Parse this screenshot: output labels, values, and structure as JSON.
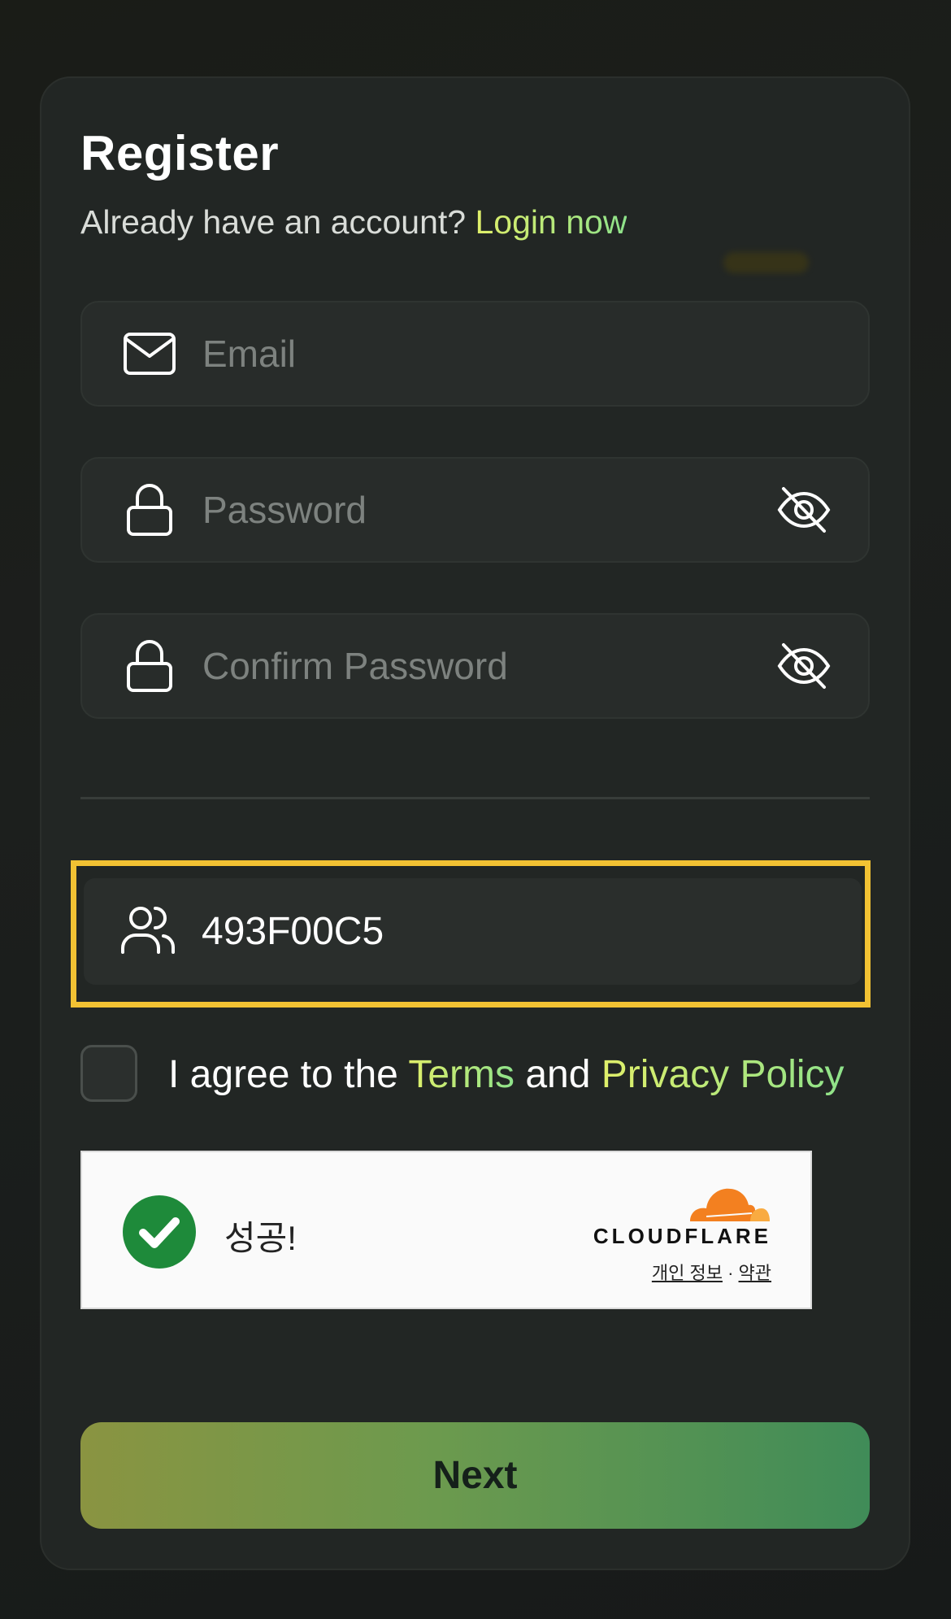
{
  "register": {
    "title": "Register",
    "subtitle_prefix": "Already have an account? ",
    "login_link": "Login now"
  },
  "fields": {
    "email_placeholder": "Email",
    "password_placeholder": "Password",
    "confirm_password_placeholder": "Confirm Password",
    "referral_value": "493F00C5"
  },
  "agreement": {
    "prefix": "I agree to the ",
    "terms": "Terms",
    "middle": " and ",
    "privacy": "Privacy Policy"
  },
  "turnstile": {
    "status": "성공!",
    "brand": "CLOUDFLARE",
    "privacy_link": "개인 정보",
    "separator": "·",
    "terms_link": "약관"
  },
  "actions": {
    "next_label": "Next"
  },
  "colors": {
    "accent_yellow": "#e0ef6a",
    "accent_green": "#8ee28a",
    "highlight_border": "#f2c233",
    "success_green": "#1e8a3a",
    "cloudflare_orange": "#f38020"
  },
  "icons": [
    "mail-icon",
    "lock-icon",
    "eye-off-icon",
    "users-icon",
    "checkmark-icon",
    "cloudflare-logo"
  ]
}
